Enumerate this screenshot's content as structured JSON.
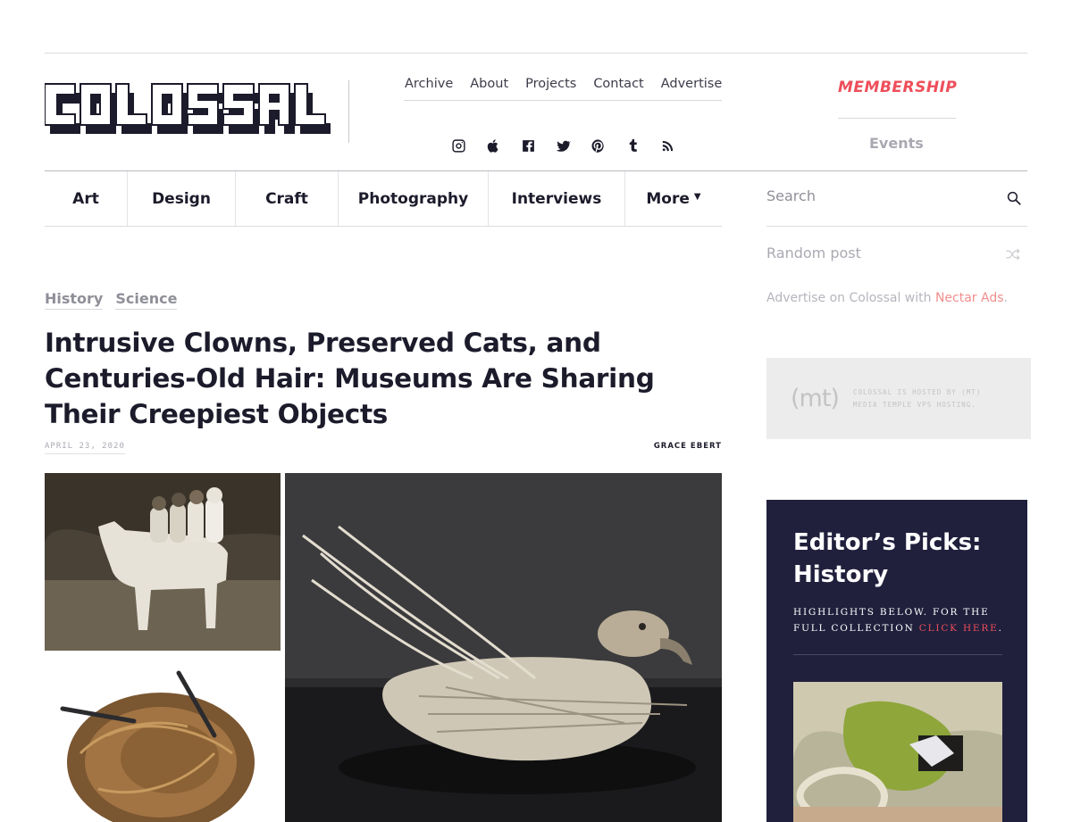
{
  "brand": {
    "logo_text": "COLOSSAL"
  },
  "topnav": {
    "items": [
      {
        "label": "Archive"
      },
      {
        "label": "About"
      },
      {
        "label": "Projects"
      },
      {
        "label": "Contact"
      },
      {
        "label": "Advertise"
      }
    ]
  },
  "social": [
    "instagram-icon",
    "apple-icon",
    "facebook-icon",
    "twitter-icon",
    "pinterest-icon",
    "tumblr-icon",
    "rss-icon"
  ],
  "header": {
    "membership": "MEMBERSHIP",
    "events": "Events"
  },
  "catnav": {
    "items": [
      {
        "label": "Art"
      },
      {
        "label": "Design"
      },
      {
        "label": "Craft"
      },
      {
        "label": "Photography"
      },
      {
        "label": "Interviews"
      },
      {
        "label": "More"
      }
    ]
  },
  "sidebar": {
    "search_placeholder": "Search",
    "random_post": "Random post",
    "advertise_prefix": "Advertise on Colossal with ",
    "advertise_link": "Nectar Ads",
    "advertise_suffix": ".",
    "host_logo": "(mt)",
    "host_text": "Colossal is hosted by (mt) Media Temple VPS hosting.",
    "picks_title": "Editor’s Picks: History",
    "picks_desc": "Highlights below. For the full collection ",
    "picks_link": "click here",
    "picks_suffix": "."
  },
  "article": {
    "tags": [
      "History",
      "Science"
    ],
    "title": "Intrusive Clowns, Preserved Cats, and Centuries-Old Hair: Museums Are Sharing Their Creepiest Objects",
    "date": "APRIL 23, 2020",
    "author": "GRACE EBERT"
  },
  "colors": {
    "accent": "#ee4e5a",
    "ink": "#1b1b2b",
    "picks_bg": "#20203d",
    "muted": "#a9a9b3"
  }
}
